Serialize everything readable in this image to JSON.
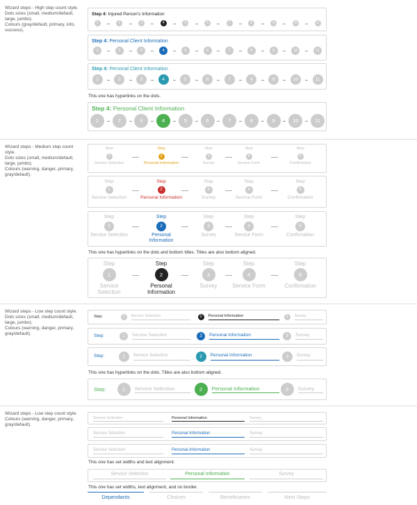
{
  "sections": {
    "high": "Wizard steps - High step count style.\nDots sizes (small, medium/default, large, jumbo).\nColours (gray/default, primary, info, success).",
    "medium": "Wizard steps - Medium step count style.\nDots sizes (small, medium/default, large, jumbo).\nColours (warning, danger, primary, gray/default).",
    "low": "Wizard steps - Low step count style.\nDots sizes (small, medium/default, large, jumbo).\nColours (warning, danger, primary, gray/default).",
    "lowwidth": "Wizard steps - Low step count style.\nColours (warning, danger, primary, gray/default)."
  },
  "high": {
    "step_prefix": "Step 4",
    "titles": [
      "Injured Person's Information",
      "Personal Client Information",
      "Personal Client Information",
      "Personal Client Information"
    ],
    "numbers": [
      "1",
      "2",
      "3",
      "4",
      "5",
      "6",
      "7",
      "8",
      "9",
      "10",
      "11"
    ],
    "note": "This one has hyperlinks on the dots."
  },
  "medium": {
    "steps": [
      "Step 1",
      "Step 2",
      "Step 3",
      "Step 4",
      "Step 5"
    ],
    "word": "Step",
    "titles": [
      "Service Selection",
      "Personal Information",
      "Survey",
      "Service Form",
      "Confirmation"
    ],
    "numbers": [
      "1",
      "2",
      "3",
      "4",
      "5"
    ],
    "note": "This one has hyperlinks on the dots and bottom titles. Titles are also bottom aligned."
  },
  "low": {
    "label": "Step:",
    "titles": [
      "Service Selection",
      "Personal Information",
      "Survey"
    ],
    "numbers": [
      "1",
      "2",
      "3"
    ],
    "note": "This one has hyperlinks on the dots. Titles are also bottom aligned."
  },
  "lowwidth": {
    "titles": [
      "Service Selection",
      "Personal Information",
      "Survey"
    ],
    "note1": "This one has set widths and text alignment.",
    "note2": "This one has set widths, text alignment, and no border.",
    "tabs": [
      "Dependants",
      "Choices",
      "Beneficiaries",
      "Next Steps"
    ]
  },
  "colors": {
    "gray": "#cccccc",
    "dark": "#222222",
    "primary": "#1a6bb8",
    "info": "#2a9ab0",
    "success": "#4caf50",
    "warning": "#e4a21a",
    "danger": "#c9302c",
    "muted": "#bbbbbb"
  }
}
